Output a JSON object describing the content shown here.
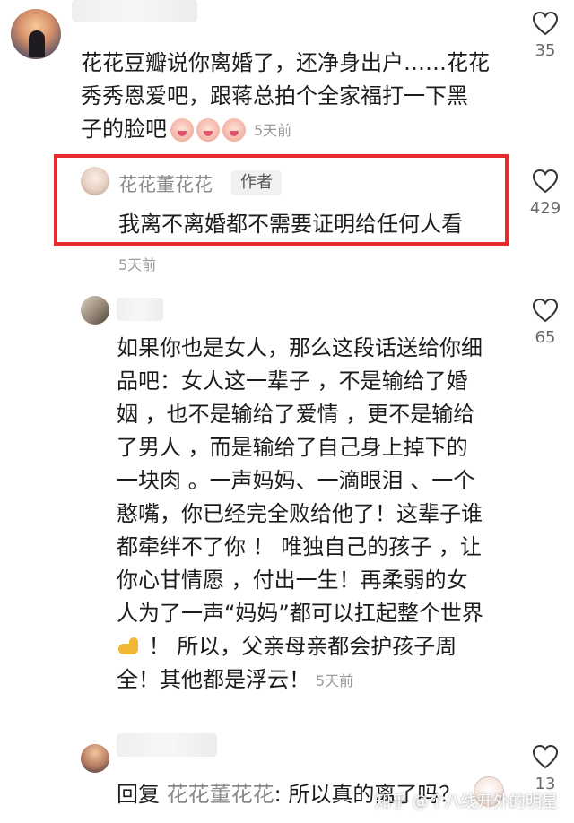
{
  "comments": [
    {
      "lines": [
        "花花豆瓣说你离婚了，还净身出户……花花",
        "秀秀恩爱吧，跟蒋总拍个全家福打一下黑",
        "子的脸吧"
      ],
      "time": "5天前",
      "likes": "35"
    },
    {
      "username": "花花董花花",
      "tag": "作者",
      "text": "我离不离婚都不需要证明给任何人看",
      "time": "5天前",
      "likes": "429"
    },
    {
      "lines": [
        "如果你也是女人，那么这段话送给你细",
        "品吧：女人这一辈子 ，不是输给了婚",
        "姻 ，也不是输给了爱情 ，更不是输给",
        "了男人 ，而是输给了自己身上掉下的",
        "一块肉 。一声妈妈、一滴眼泪 、一个",
        "憨嘴，你已经完全败给他了！这辈子谁",
        "都牵绊不了你 ！ 唯独自己的孩子 ，让",
        "你心甘情愿 ，付出一生！再柔弱的女",
        "人为了一声“妈妈”都可以扛起整个世界"
      ],
      "last_line": " ！ 所以，父亲母亲都会护孩子周",
      "final_line": "全！其他都是浮云！",
      "time": "5天前",
      "likes": "65"
    },
    {
      "reply_prefix": "回复",
      "reply_name": "花花董花花",
      "text": ": 所以真的离了吗？",
      "likes": "13"
    }
  ],
  "watermark": "知乎 @个八线开外的明星",
  "colors": {
    "highlight": "#e52b2b",
    "muted": "#9a9a9a",
    "text": "#1c1c1c"
  }
}
